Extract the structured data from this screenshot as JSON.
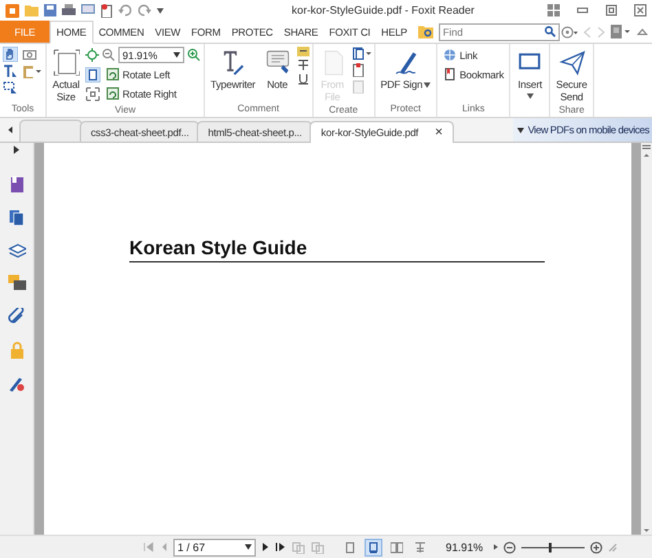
{
  "window": {
    "title": "kor-kor-StyleGuide.pdf - Foxit Reader"
  },
  "menu_tabs": [
    {
      "label": "FILE",
      "kind": "file",
      "selected": false
    },
    {
      "label": "HOME",
      "kind": "tab",
      "selected": true
    },
    {
      "label": "COMMEN",
      "kind": "tab",
      "selected": false
    },
    {
      "label": "VIEW",
      "kind": "tab",
      "selected": false
    },
    {
      "label": "FORM",
      "kind": "tab",
      "selected": false
    },
    {
      "label": "PROTEC",
      "kind": "tab",
      "selected": false
    },
    {
      "label": "SHARE",
      "kind": "tab",
      "selected": false
    },
    {
      "label": "FOXIT CI",
      "kind": "tab",
      "selected": false
    },
    {
      "label": "HELP",
      "kind": "tab",
      "selected": false
    }
  ],
  "search": {
    "placeholder": "Find"
  },
  "ribbon_groups": [
    {
      "label": "Tools"
    },
    {
      "label": "View",
      "zoom_field": "91.91%",
      "buttons": [
        {
          "label": "Actual Size",
          "kind": "large"
        },
        {
          "label": "Rotate Left",
          "kind": "small"
        },
        {
          "label": "Rotate Right",
          "kind": "small"
        }
      ]
    },
    {
      "label": "Comment",
      "buttons": [
        {
          "label": "Typewriter",
          "kind": "large"
        },
        {
          "label": "Note",
          "kind": "large"
        }
      ]
    },
    {
      "label": "Create",
      "buttons": [
        {
          "label": "From File",
          "kind": "large",
          "disabled": true
        }
      ]
    },
    {
      "label": "Protect",
      "buttons": [
        {
          "label": "PDF Sign",
          "kind": "large"
        }
      ]
    },
    {
      "label": "Links",
      "buttons": [
        {
          "label": "Link",
          "kind": "small"
        },
        {
          "label": "Bookmark",
          "kind": "small"
        }
      ]
    },
    {
      "buttons": [
        {
          "label": "Insert",
          "kind": "large"
        }
      ]
    },
    {
      "label": "Share",
      "buttons": [
        {
          "label": "Secure Send",
          "kind": "large"
        }
      ]
    }
  ],
  "doc_tabs": [
    {
      "label": "css3-cheat-sheet.pdf...",
      "selected": false
    },
    {
      "label": "html5-cheat-sheet.p...",
      "selected": false
    },
    {
      "label": "kor-kor-StyleGuide.pdf",
      "selected": true
    }
  ],
  "close_tab": "×",
  "mobile_banner": "View PDFs on mobile devices",
  "document": {
    "heading": "Korean Style Guide"
  },
  "status_bar": {
    "page": "1 / 67",
    "view_modes": [
      {
        "selected": false
      },
      {
        "selected": true
      },
      {
        "selected": false
      },
      {
        "selected": false
      }
    ],
    "zoom": "91.91%",
    "zoom_slider": {
      "level": 0.45
    }
  }
}
